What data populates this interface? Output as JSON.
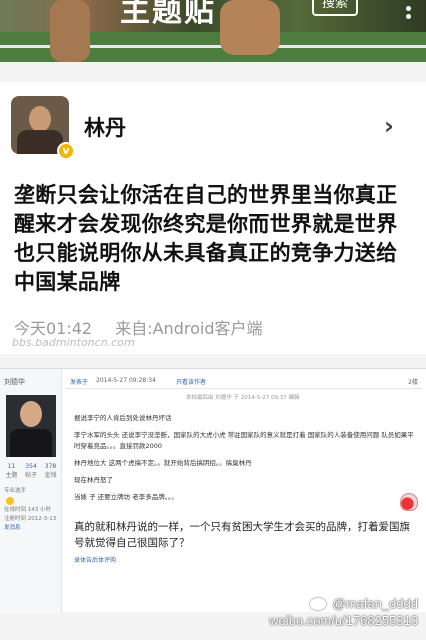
{
  "banner": {
    "title": "主题贴",
    "button_label": "搜索"
  },
  "weibo": {
    "username": "林丹",
    "verified_badge": "v",
    "chevron": "›",
    "text": "垄断只会让你活在自己的世界里当你真正醒来才会发现你终究是你而世界就是世界也只能说明你从未具备真正的竞争力送给中国某品牌",
    "time": "今天01:42",
    "source": "来自:Android客户端",
    "site_watermark": "bbs.badmintoncn.com"
  },
  "forum": {
    "user_name": "刘德华",
    "stats": [
      {
        "value": "11",
        "label": "主题"
      },
      {
        "value": "354",
        "label": "帖子"
      },
      {
        "value": "378",
        "label": "金钱"
      }
    ],
    "side_info": [
      "专业选手",
      "在线时间 143 小时",
      "注册时间 2012-3-13",
      "发消息"
    ],
    "post_name": "发表于",
    "post_date": "2014-5-27 09:28:34",
    "post_author": "只看该作者",
    "post_floor": "2楼",
    "quote_head": "本帖最后由 刘德华 于 2014-5-27 09:37 编辑",
    "paragraphs": [
      "据说李宁的人肯后到处说林丹坏话",
      "李宁水军的头头 还说李宁没垄断，国家队的大虎小虎 常驻国家队的意义就是打着 国家队的人装备使用问题 队员如果平时穿着竞品。。。直接罚款2000",
      "林丹地位大 这两个虎搞不定。。就开始背后搞阴招。。搞臭林丹",
      "现在林丹怒了",
      "当婊 子 还要立牌坊 老李多品牌。。。"
    ],
    "highlight": "真的就和林丹说的一样，一个只有贫困大学生才会买的品牌，打着爱国旗号就觉得自己很国际了？",
    "footer_link": "录体告后体评购"
  },
  "watermark": {
    "handle": "@mafan_dddd",
    "url": "weibo.com/u/1768255310"
  }
}
